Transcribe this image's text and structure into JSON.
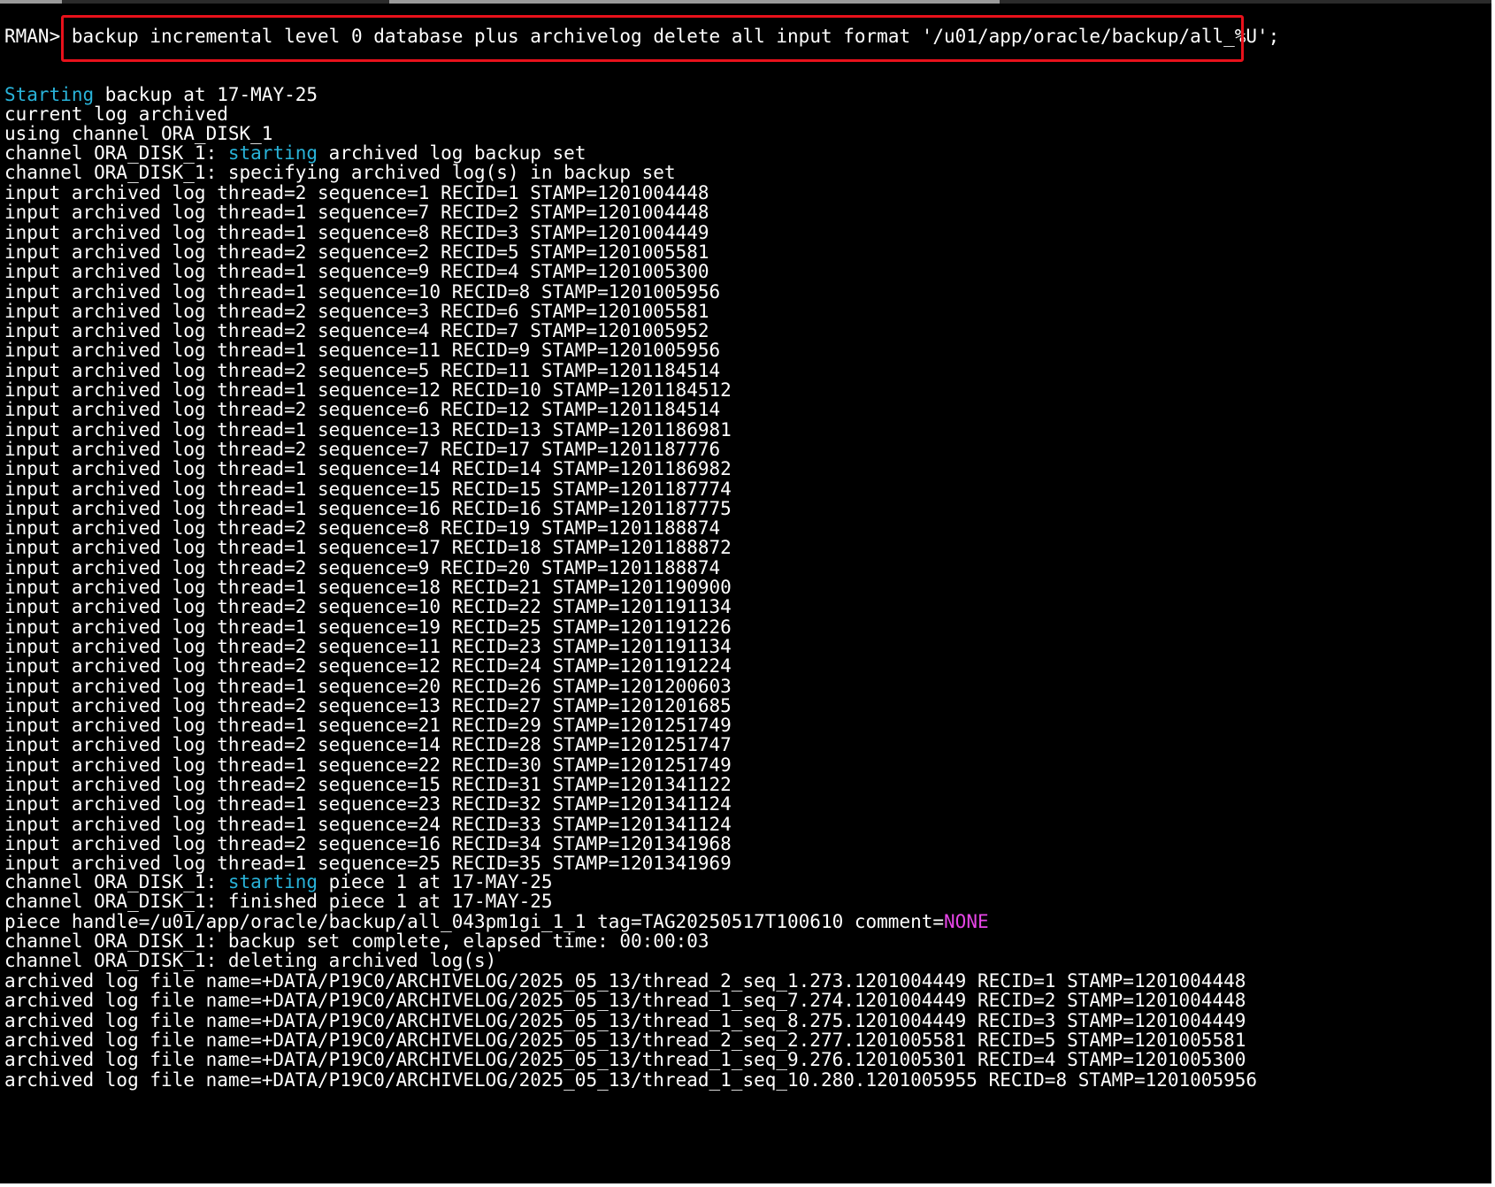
{
  "prompt": "RMAN>",
  "command": "backup incremental level 0 database plus archivelog delete all input format '/u01/app/oracle/backup/all_%U';",
  "colors": {
    "background": "#000000",
    "text": "#ffffff",
    "keyword_highlight": "#29b3d9",
    "none_highlight": "#e645e6",
    "annotation_box": "#e8111b"
  },
  "output": {
    "starting_backup": {
      "word": "Starting",
      "rest": " backup at 17-MAY-25"
    },
    "current_log": "current log archived",
    "using_channel": "using channel ORA_DISK_1",
    "channel_start_set": {
      "prefix": "channel ORA_DISK_1: ",
      "word": "starting",
      "rest": " archived log backup set"
    },
    "channel_specifying": "channel ORA_DISK_1: specifying archived log(s) in backup set",
    "input_logs": [
      "input archived log thread=2 sequence=1 RECID=1 STAMP=1201004448",
      "input archived log thread=1 sequence=7 RECID=2 STAMP=1201004448",
      "input archived log thread=1 sequence=8 RECID=3 STAMP=1201004449",
      "input archived log thread=2 sequence=2 RECID=5 STAMP=1201005581",
      "input archived log thread=1 sequence=9 RECID=4 STAMP=1201005300",
      "input archived log thread=1 sequence=10 RECID=8 STAMP=1201005956",
      "input archived log thread=2 sequence=3 RECID=6 STAMP=1201005581",
      "input archived log thread=2 sequence=4 RECID=7 STAMP=1201005952",
      "input archived log thread=1 sequence=11 RECID=9 STAMP=1201005956",
      "input archived log thread=2 sequence=5 RECID=11 STAMP=1201184514",
      "input archived log thread=1 sequence=12 RECID=10 STAMP=1201184512",
      "input archived log thread=2 sequence=6 RECID=12 STAMP=1201184514",
      "input archived log thread=1 sequence=13 RECID=13 STAMP=1201186981",
      "input archived log thread=2 sequence=7 RECID=17 STAMP=1201187776",
      "input archived log thread=1 sequence=14 RECID=14 STAMP=1201186982",
      "input archived log thread=1 sequence=15 RECID=15 STAMP=1201187774",
      "input archived log thread=1 sequence=16 RECID=16 STAMP=1201187775",
      "input archived log thread=2 sequence=8 RECID=19 STAMP=1201188874",
      "input archived log thread=1 sequence=17 RECID=18 STAMP=1201188872",
      "input archived log thread=2 sequence=9 RECID=20 STAMP=1201188874",
      "input archived log thread=1 sequence=18 RECID=21 STAMP=1201190900",
      "input archived log thread=2 sequence=10 RECID=22 STAMP=1201191134",
      "input archived log thread=1 sequence=19 RECID=25 STAMP=1201191226",
      "input archived log thread=2 sequence=11 RECID=23 STAMP=1201191134",
      "input archived log thread=2 sequence=12 RECID=24 STAMP=1201191224",
      "input archived log thread=1 sequence=20 RECID=26 STAMP=1201200603",
      "input archived log thread=2 sequence=13 RECID=27 STAMP=1201201685",
      "input archived log thread=1 sequence=21 RECID=29 STAMP=1201251749",
      "input archived log thread=2 sequence=14 RECID=28 STAMP=1201251747",
      "input archived log thread=1 sequence=22 RECID=30 STAMP=1201251749",
      "input archived log thread=2 sequence=15 RECID=31 STAMP=1201341122",
      "input archived log thread=1 sequence=23 RECID=32 STAMP=1201341124",
      "input archived log thread=1 sequence=24 RECID=33 STAMP=1201341124",
      "input archived log thread=2 sequence=16 RECID=34 STAMP=1201341968",
      "input archived log thread=1 sequence=25 RECID=35 STAMP=1201341969"
    ],
    "channel_start_piece": {
      "prefix": "channel ORA_DISK_1: ",
      "word": "starting",
      "rest": " piece 1 at 17-MAY-25"
    },
    "channel_finished_piece": "channel ORA_DISK_1: finished piece 1 at 17-MAY-25",
    "piece_handle": {
      "text": "piece handle=/u01/app/oracle/backup/all_043pm1gi_1_1 tag=TAG20250517T100610 comment=",
      "none": "NONE"
    },
    "backup_complete": "channel ORA_DISK_1: backup set complete, elapsed time: 00:00:03",
    "deleting": "channel ORA_DISK_1: deleting archived log(s)",
    "deleted_logs": [
      "archived log file name=+DATA/P19C0/ARCHIVELOG/2025_05_13/thread_2_seq_1.273.1201004449 RECID=1 STAMP=1201004448",
      "archived log file name=+DATA/P19C0/ARCHIVELOG/2025_05_13/thread_1_seq_7.274.1201004449 RECID=2 STAMP=1201004448",
      "archived log file name=+DATA/P19C0/ARCHIVELOG/2025_05_13/thread_1_seq_8.275.1201004449 RECID=3 STAMP=1201004449",
      "archived log file name=+DATA/P19C0/ARCHIVELOG/2025_05_13/thread_2_seq_2.277.1201005581 RECID=5 STAMP=1201005581",
      "archived log file name=+DATA/P19C0/ARCHIVELOG/2025_05_13/thread_1_seq_9.276.1201005301 RECID=4 STAMP=1201005300",
      "archived log file name=+DATA/P19C0/ARCHIVELOG/2025_05_13/thread_1_seq_10.280.1201005955 RECID=8 STAMP=1201005956"
    ]
  }
}
